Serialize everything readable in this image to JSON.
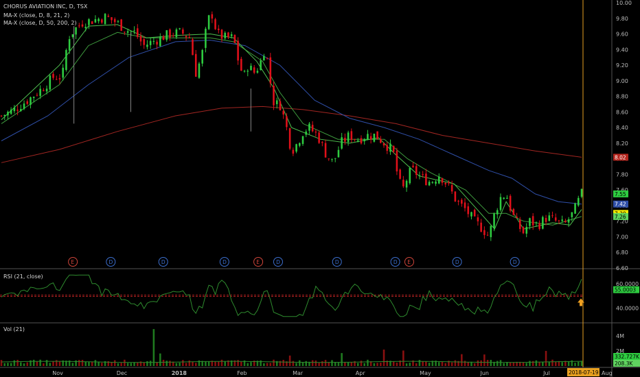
{
  "legend": {
    "title": "CHORUS AVIATION INC, D, TSX",
    "ma1": "MA-X (close, D, 8, 21, 2)",
    "ma2": "MA-X (close, D, 50, 200, 2)"
  },
  "rsi_label": "RSI (21, close)",
  "vol_label": "Vol (21)",
  "colors": {
    "up": "#2ecc40",
    "down": "#e0101a",
    "ma_fast": "#2f9e2f",
    "ma_slow": "#3f9d3f",
    "ma50": "#2f4fa8",
    "ma200": "#a32622",
    "rsi": "#2e8b2e",
    "rsi_level": "#b02020",
    "cursor": "#e8a020",
    "grid": "#555555"
  },
  "chart_data": {
    "type": "candlestick",
    "title": "CHORUS AVIATION INC, D, TSX",
    "price_ticks": [
      "10.00",
      "9.80",
      "9.60",
      "9.40",
      "9.20",
      "9.00",
      "8.80",
      "8.60",
      "8.40",
      "8.20",
      "8.00",
      "7.80",
      "7.60",
      "7.40",
      "7.20",
      "7.00",
      "6.80",
      "6.60"
    ],
    "price_range": [
      6.6,
      10.0
    ],
    "x_labels": [
      "Nov",
      "Dec",
      "2018",
      "Feb",
      "Mar",
      "Apr",
      "May",
      "Jun",
      "Jul",
      "Aug"
    ],
    "last_date": "2018-07-19",
    "price_badges": [
      {
        "text": "8.02",
        "value": 8.02,
        "bg": "#b5261e",
        "fg": "#ffffff"
      },
      {
        "text": "7.55",
        "value": 7.55,
        "bg": "#2ecc40",
        "fg": "#000000"
      },
      {
        "text": "7.42",
        "value": 7.42,
        "bg": "#2f4fa8",
        "fg": "#ffffff"
      },
      {
        "text": "7.30",
        "value": 7.3,
        "bg": "#f4e900",
        "fg": "#000000"
      },
      {
        "text": "7.26",
        "value": 7.26,
        "bg": "#5fd35f",
        "fg": "#000000"
      }
    ],
    "events": [
      {
        "type": "E",
        "x": 0.125
      },
      {
        "type": "D",
        "x": 0.19
      },
      {
        "type": "D",
        "x": 0.28
      },
      {
        "type": "D",
        "x": 0.385
      },
      {
        "type": "E",
        "x": 0.443
      },
      {
        "type": "D",
        "x": 0.477
      },
      {
        "type": "D",
        "x": 0.578
      },
      {
        "type": "D",
        "x": 0.678
      },
      {
        "type": "E",
        "x": 0.702
      },
      {
        "type": "D",
        "x": 0.784
      },
      {
        "type": "D",
        "x": 0.883
      }
    ],
    "close_path": [
      [
        0,
        8.55
      ],
      [
        0.02,
        8.62
      ],
      [
        0.045,
        8.75
      ],
      [
        0.07,
        8.9
      ],
      [
        0.09,
        9.05
      ],
      [
        0.105,
        9.05
      ],
      [
        0.115,
        9.55
      ],
      [
        0.125,
        9.65
      ],
      [
        0.14,
        9.75
      ],
      [
        0.16,
        9.78
      ],
      [
        0.18,
        9.82
      ],
      [
        0.2,
        9.74
      ],
      [
        0.215,
        9.65
      ],
      [
        0.23,
        9.62
      ],
      [
        0.245,
        9.45
      ],
      [
        0.26,
        9.5
      ],
      [
        0.275,
        9.55
      ],
      [
        0.29,
        9.6
      ],
      [
        0.31,
        9.62
      ],
      [
        0.325,
        9.55
      ],
      [
        0.335,
        9.1
      ],
      [
        0.345,
        9.3
      ],
      [
        0.355,
        9.75
      ],
      [
        0.362,
        9.88
      ],
      [
        0.372,
        9.6
      ],
      [
        0.385,
        9.55
      ],
      [
        0.4,
        9.55
      ],
      [
        0.41,
        9.2
      ],
      [
        0.418,
        9.05
      ],
      [
        0.425,
        9.2
      ],
      [
        0.435,
        9.1
      ],
      [
        0.445,
        9.2
      ],
      [
        0.455,
        9.45
      ],
      [
        0.462,
        9.05
      ],
      [
        0.47,
        8.7
      ],
      [
        0.48,
        8.7
      ],
      [
        0.49,
        8.45
      ],
      [
        0.5,
        8.1
      ],
      [
        0.51,
        8.2
      ],
      [
        0.52,
        8.35
      ],
      [
        0.53,
        8.4
      ],
      [
        0.545,
        8.3
      ],
      [
        0.56,
        8.05
      ],
      [
        0.572,
        7.95
      ],
      [
        0.585,
        8.2
      ],
      [
        0.6,
        8.3
      ],
      [
        0.615,
        8.25
      ],
      [
        0.63,
        8.3
      ],
      [
        0.645,
        8.3
      ],
      [
        0.66,
        8.2
      ],
      [
        0.675,
        8.1
      ],
      [
        0.685,
        7.7
      ],
      [
        0.695,
        7.6
      ],
      [
        0.7,
        7.8
      ],
      [
        0.71,
        7.85
      ],
      [
        0.725,
        7.75
      ],
      [
        0.74,
        7.7
      ],
      [
        0.755,
        7.8
      ],
      [
        0.77,
        7.65
      ],
      [
        0.785,
        7.45
      ],
      [
        0.8,
        7.35
      ],
      [
        0.815,
        7.2
      ],
      [
        0.83,
        7.1
      ],
      [
        0.84,
        7.0
      ],
      [
        0.85,
        7.3
      ],
      [
        0.86,
        7.5
      ],
      [
        0.87,
        7.55
      ],
      [
        0.88,
        7.3
      ],
      [
        0.89,
        7.15
      ],
      [
        0.9,
        7.05
      ],
      [
        0.91,
        7.2
      ],
      [
        0.925,
        7.15
      ],
      [
        0.94,
        7.25
      ],
      [
        0.955,
        7.2
      ],
      [
        0.97,
        7.15
      ],
      [
        0.985,
        7.3
      ],
      [
        1.0,
        7.55
      ]
    ],
    "ma_fast": [
      [
        0,
        8.5
      ],
      [
        0.1,
        9.2
      ],
      [
        0.15,
        9.7
      ],
      [
        0.2,
        9.72
      ],
      [
        0.25,
        9.55
      ],
      [
        0.3,
        9.58
      ],
      [
        0.36,
        9.6
      ],
      [
        0.4,
        9.55
      ],
      [
        0.44,
        9.25
      ],
      [
        0.47,
        8.9
      ],
      [
        0.5,
        8.4
      ],
      [
        0.55,
        8.25
      ],
      [
        0.6,
        8.2
      ],
      [
        0.65,
        8.27
      ],
      [
        0.68,
        8.05
      ],
      [
        0.72,
        7.78
      ],
      [
        0.78,
        7.68
      ],
      [
        0.82,
        7.35
      ],
      [
        0.85,
        7.1
      ],
      [
        0.87,
        7.45
      ],
      [
        0.9,
        7.1
      ],
      [
        0.95,
        7.18
      ],
      [
        0.98,
        7.15
      ],
      [
        1.0,
        7.35
      ]
    ],
    "ma_slow": [
      [
        0,
        8.45
      ],
      [
        0.1,
        8.95
      ],
      [
        0.15,
        9.45
      ],
      [
        0.2,
        9.62
      ],
      [
        0.25,
        9.55
      ],
      [
        0.3,
        9.55
      ],
      [
        0.36,
        9.55
      ],
      [
        0.4,
        9.5
      ],
      [
        0.45,
        9.25
      ],
      [
        0.48,
        8.85
      ],
      [
        0.52,
        8.45
      ],
      [
        0.58,
        8.25
      ],
      [
        0.62,
        8.25
      ],
      [
        0.66,
        8.25
      ],
      [
        0.7,
        8.0
      ],
      [
        0.74,
        7.82
      ],
      [
        0.8,
        7.6
      ],
      [
        0.84,
        7.3
      ],
      [
        0.87,
        7.3
      ],
      [
        0.9,
        7.2
      ],
      [
        0.95,
        7.15
      ],
      [
        1.0,
        7.26
      ]
    ],
    "ma50": [
      [
        0,
        8.23
      ],
      [
        0.08,
        8.55
      ],
      [
        0.15,
        8.95
      ],
      [
        0.22,
        9.3
      ],
      [
        0.3,
        9.5
      ],
      [
        0.36,
        9.52
      ],
      [
        0.42,
        9.45
      ],
      [
        0.48,
        9.2
      ],
      [
        0.54,
        8.75
      ],
      [
        0.6,
        8.52
      ],
      [
        0.66,
        8.4
      ],
      [
        0.72,
        8.25
      ],
      [
        0.78,
        8.05
      ],
      [
        0.84,
        7.85
      ],
      [
        0.88,
        7.75
      ],
      [
        0.92,
        7.55
      ],
      [
        0.96,
        7.45
      ],
      [
        1.0,
        7.42
      ]
    ],
    "ma200": [
      [
        0,
        7.95
      ],
      [
        0.1,
        8.12
      ],
      [
        0.2,
        8.35
      ],
      [
        0.3,
        8.55
      ],
      [
        0.38,
        8.65
      ],
      [
        0.45,
        8.67
      ],
      [
        0.52,
        8.63
      ],
      [
        0.6,
        8.55
      ],
      [
        0.68,
        8.45
      ],
      [
        0.76,
        8.3
      ],
      [
        0.84,
        8.2
      ],
      [
        0.92,
        8.1
      ],
      [
        1.0,
        8.02
      ]
    ],
    "rsi": {
      "level_label": "55.0003",
      "ticks": [
        "60.0000",
        "40.0000"
      ],
      "range": [
        30,
        70
      ],
      "level": 50
    },
    "volume": {
      "ticks": [
        "4M",
        "2M"
      ],
      "badges": [
        {
          "text": "332.727K",
          "bg": "#2ecc40"
        },
        {
          "text": "208.3K",
          "bg": "#5fd35f"
        }
      ]
    }
  }
}
